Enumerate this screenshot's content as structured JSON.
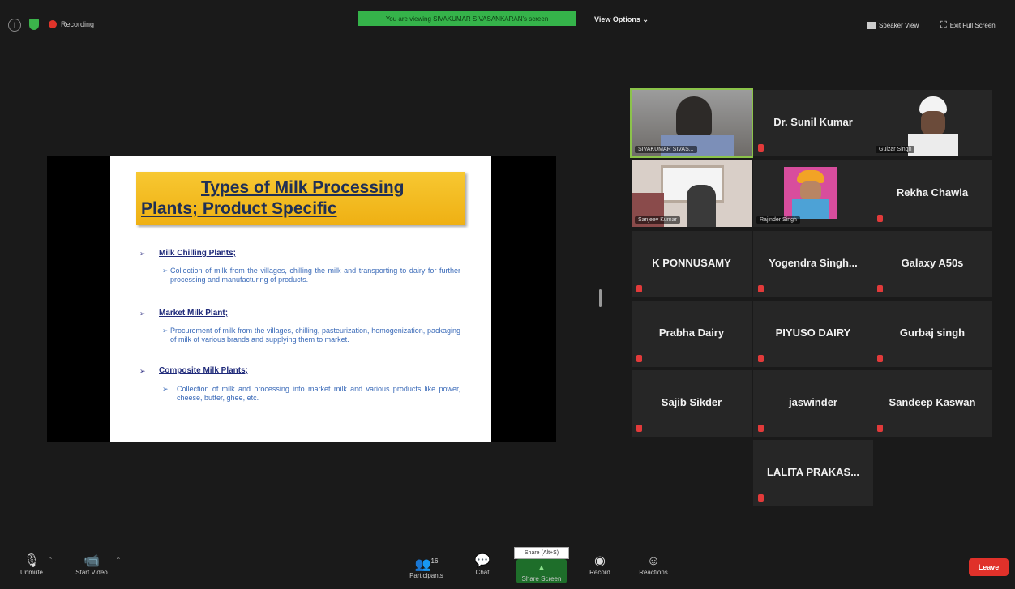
{
  "top": {
    "recording_label": "Recording",
    "share_banner": "You are viewing SIVAKUMAR SIVASANKARAN's screen",
    "view_options": "View Options ⌄",
    "speaker_view": "Speaker View",
    "exit_full_screen": "Exit Full Screen"
  },
  "slide": {
    "title_line1": "Types of Milk Processing",
    "title_line2": "Plants; Product Specific",
    "sections": [
      {
        "heading": "Milk Chilling Plants;",
        "text": "Collection of milk from the villages, chilling the milk and transporting to dairy for further processing and manufacturing of products."
      },
      {
        "heading": "Market Milk Plant;",
        "text": "Procurement of milk from the villages, chilling, pasteurization, homogenization, packaging of milk of various brands and supplying them to market."
      },
      {
        "heading": "Composite Milk Plants;",
        "text": "Collection of milk and processing into market milk and various products like power, cheese, butter, ghee, etc."
      }
    ]
  },
  "participants": [
    {
      "name": "SIVAKUMAR SIVAS...",
      "type": "video"
    },
    {
      "name": "Dr. Sunil Kumar",
      "type": "name"
    },
    {
      "name": "Gulzar Singh",
      "type": "video"
    },
    {
      "name": "Sanjeev Kumar",
      "type": "video"
    },
    {
      "name": "Rajinder Singh",
      "type": "video"
    },
    {
      "name": "Rekha Chawla",
      "type": "name"
    },
    {
      "name": "K PONNUSAMY",
      "type": "name"
    },
    {
      "name": "Yogendra  Singh...",
      "type": "name"
    },
    {
      "name": "Galaxy A50s",
      "type": "name"
    },
    {
      "name": "Prabha Dairy",
      "type": "name"
    },
    {
      "name": "PIYUSO DAIRY",
      "type": "name"
    },
    {
      "name": "Gurbaj singh",
      "type": "name"
    },
    {
      "name": "Sajib Sikder",
      "type": "name"
    },
    {
      "name": "jaswinder",
      "type": "name"
    },
    {
      "name": "Sandeep Kaswan",
      "type": "name"
    },
    {
      "name": "LALITA  PRAKAS...",
      "type": "name"
    }
  ],
  "toolbar": {
    "unmute": "Unmute",
    "start_video": "Start Video",
    "participants": "Participants",
    "participants_count": "16",
    "chat": "Chat",
    "share_tooltip": "Share (Alt+S)",
    "share_screen": "Share Screen",
    "record": "Record",
    "reactions": "Reactions",
    "leave": "Leave"
  },
  "colors": {
    "share_banner": "#35b34a",
    "leave": "#e0312a",
    "active_speaker": "#8bc34a",
    "slide_title_bg": "#f2b91e"
  }
}
